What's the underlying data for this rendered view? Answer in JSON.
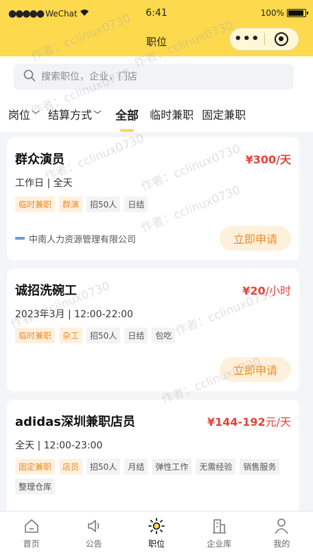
{
  "status": {
    "carrier": "WeChat",
    "time": "6:41",
    "battery": "100%"
  },
  "navbar": {
    "title": "职位"
  },
  "search": {
    "placeholder": "搜索职位，企业，门店"
  },
  "filters": [
    {
      "label": "岗位",
      "has_dropdown": true
    },
    {
      "label": "结算方式",
      "has_dropdown": true
    },
    {
      "label": "全部",
      "active": true
    },
    {
      "label": "临时兼职"
    },
    {
      "label": "固定兼职"
    }
  ],
  "jobs": [
    {
      "name": "群众演员",
      "salary": "¥300/天",
      "time": "工作日 | 全天",
      "tags": [
        "临时兼职",
        "群演",
        "招50人",
        "日结"
      ],
      "company": "中南人力资源管理有限公司",
      "apply": "立即申请"
    },
    {
      "name": "诚招洗碗工",
      "salary_amount": "¥20",
      "salary_unit": "/小时",
      "time": "2023年3月 | 12:00-22:00",
      "tags": [
        "临时兼职",
        "杂工",
        "招50人",
        "日结",
        "包吃"
      ],
      "apply": "立即申请"
    },
    {
      "name": "adidas深圳兼职店员",
      "salary_amount": "¥144-192",
      "salary_unit": "元/天",
      "time": "全天 | 12:00-23:00",
      "tags": [
        "固定兼职",
        "店员",
        "招50人",
        "月结",
        "弹性工作",
        "无需经验",
        "销售服务",
        "整理仓库"
      ]
    }
  ],
  "tabbar": [
    {
      "label": "首页",
      "icon": "home-icon"
    },
    {
      "label": "公告",
      "icon": "megaphone-icon"
    },
    {
      "label": "职位",
      "icon": "sun-icon",
      "active": true
    },
    {
      "label": "企业库",
      "icon": "building-icon"
    },
    {
      "label": "我的",
      "icon": "person-icon"
    }
  ],
  "watermark": "作者：cclinux0730",
  "colors": {
    "brand": "#fcd94d",
    "accent_orange": "#f08a24",
    "price_red": "#e0443a"
  }
}
